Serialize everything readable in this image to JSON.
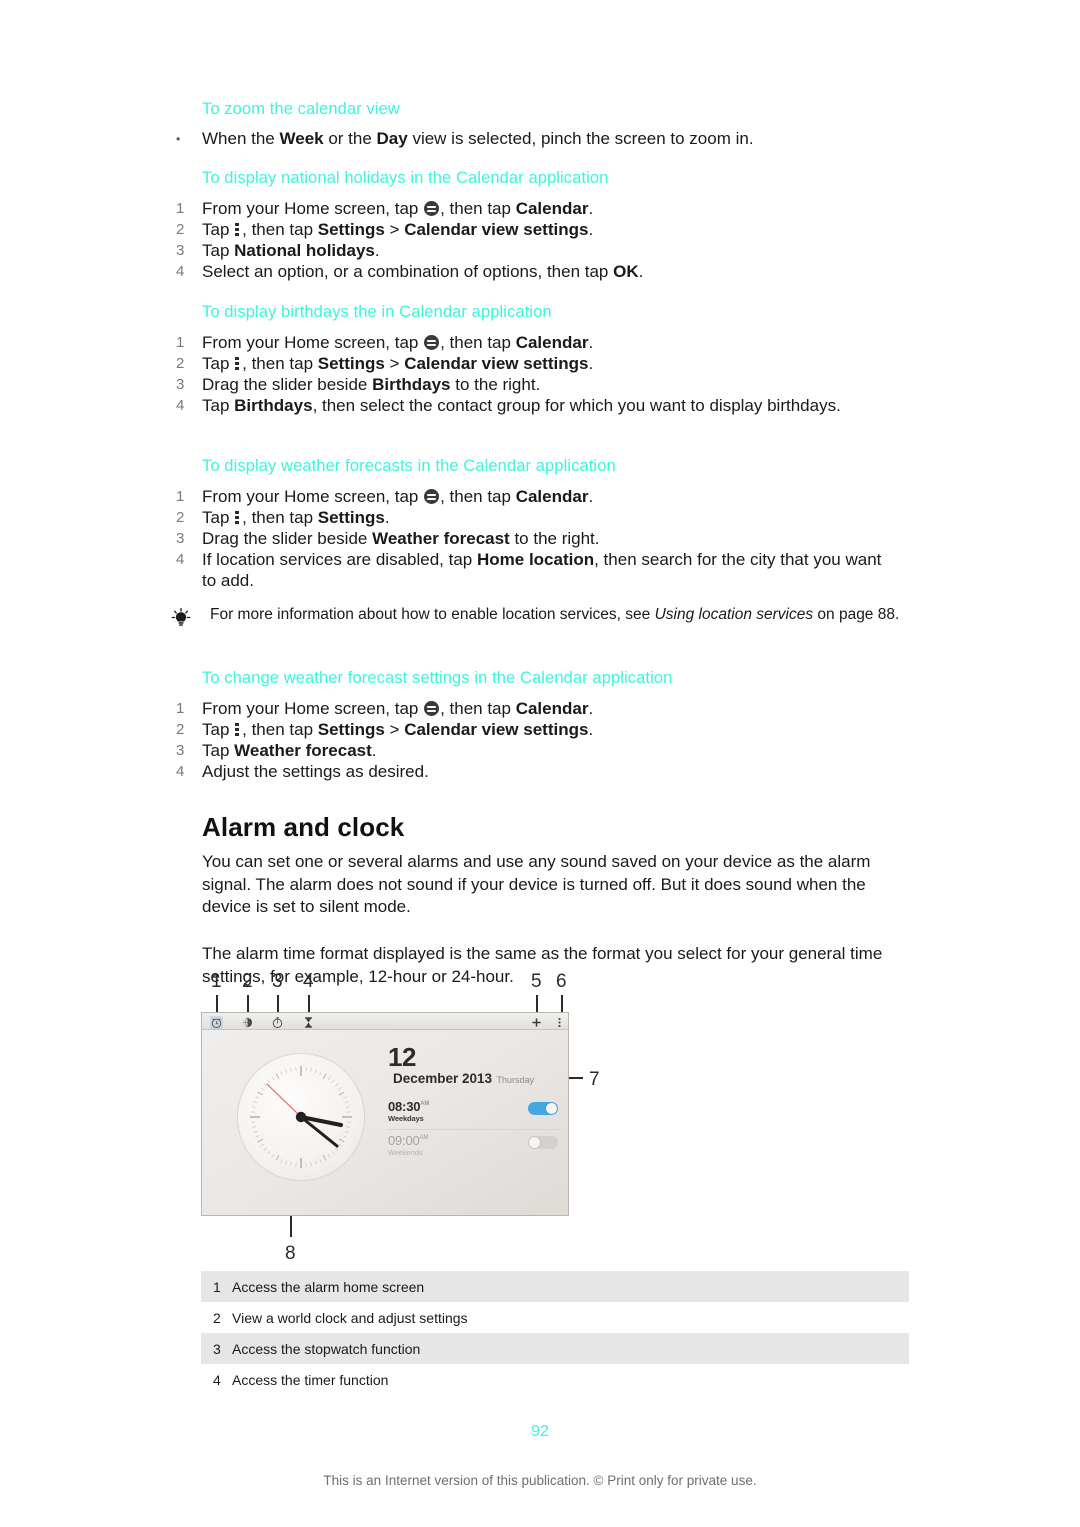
{
  "sections": [
    {
      "heading": "To zoom the calendar view",
      "steps": [
        {
          "marker": "•",
          "parts": [
            {
              "t": "When the ",
              "s": "n"
            },
            {
              "t": "Week",
              "s": "b"
            },
            {
              "t": " or the ",
              "s": "n"
            },
            {
              "t": "Day",
              "s": "b"
            },
            {
              "t": " view is selected, pinch the screen to zoom in.",
              "s": "n"
            }
          ]
        }
      ]
    },
    {
      "heading": "To display national holidays in the Calendar application",
      "steps": [
        {
          "marker": "1",
          "parts": [
            {
              "t": "From your Home screen, tap ",
              "s": "n"
            },
            {
              "t": "",
              "s": "icon-appdrawer"
            },
            {
              "t": ", then tap ",
              "s": "n"
            },
            {
              "t": "Calendar",
              "s": "b"
            },
            {
              "t": ".",
              "s": "n"
            }
          ]
        },
        {
          "marker": "2",
          "parts": [
            {
              "t": "Tap ",
              "s": "n"
            },
            {
              "t": "",
              "s": "icon-overflow"
            },
            {
              "t": ", then tap ",
              "s": "n"
            },
            {
              "t": "Settings",
              "s": "b"
            },
            {
              "t": " > ",
              "s": "n"
            },
            {
              "t": "Calendar view settings",
              "s": "b"
            },
            {
              "t": ".",
              "s": "n"
            }
          ]
        },
        {
          "marker": "3",
          "parts": [
            {
              "t": "Tap ",
              "s": "n"
            },
            {
              "t": "National holidays",
              "s": "b"
            },
            {
              "t": ".",
              "s": "n"
            }
          ]
        },
        {
          "marker": "4",
          "parts": [
            {
              "t": "Select an option, or a combination of options, then tap ",
              "s": "n"
            },
            {
              "t": "OK",
              "s": "b"
            },
            {
              "t": ".",
              "s": "n"
            }
          ]
        }
      ]
    },
    {
      "heading": "To display birthdays the in Calendar application",
      "steps": [
        {
          "marker": "1",
          "parts": [
            {
              "t": "From your Home screen, tap ",
              "s": "n"
            },
            {
              "t": "",
              "s": "icon-appdrawer"
            },
            {
              "t": ", then tap ",
              "s": "n"
            },
            {
              "t": "Calendar",
              "s": "b"
            },
            {
              "t": ".",
              "s": "n"
            }
          ]
        },
        {
          "marker": "2",
          "parts": [
            {
              "t": "Tap ",
              "s": "n"
            },
            {
              "t": "",
              "s": "icon-overflow"
            },
            {
              "t": ", then tap ",
              "s": "n"
            },
            {
              "t": "Settings",
              "s": "b"
            },
            {
              "t": " > ",
              "s": "n"
            },
            {
              "t": "Calendar view settings",
              "s": "b"
            },
            {
              "t": ".",
              "s": "n"
            }
          ]
        },
        {
          "marker": "3",
          "parts": [
            {
              "t": "Drag the slider beside ",
              "s": "n"
            },
            {
              "t": "Birthdays",
              "s": "b"
            },
            {
              "t": " to the right.",
              "s": "n"
            }
          ]
        },
        {
          "marker": "4",
          "parts": [
            {
              "t": "Tap ",
              "s": "n"
            },
            {
              "t": "Birthdays",
              "s": "b"
            },
            {
              "t": ", then select the contact group for which you want to display birthdays.",
              "s": "n"
            }
          ]
        }
      ]
    },
    {
      "heading": "To display weather forecasts in the Calendar application",
      "steps": [
        {
          "marker": "1",
          "parts": [
            {
              "t": "From your Home screen, tap ",
              "s": "n"
            },
            {
              "t": "",
              "s": "icon-appdrawer"
            },
            {
              "t": ", then tap ",
              "s": "n"
            },
            {
              "t": "Calendar",
              "s": "b"
            },
            {
              "t": ".",
              "s": "n"
            }
          ]
        },
        {
          "marker": "2",
          "parts": [
            {
              "t": "Tap ",
              "s": "n"
            },
            {
              "t": "",
              "s": "icon-overflow"
            },
            {
              "t": ", then tap ",
              "s": "n"
            },
            {
              "t": "Settings",
              "s": "b"
            },
            {
              "t": ".",
              "s": "n"
            }
          ]
        },
        {
          "marker": "3",
          "parts": [
            {
              "t": "Drag the slider beside ",
              "s": "n"
            },
            {
              "t": "Weather forecast",
              "s": "b"
            },
            {
              "t": " to the right.",
              "s": "n"
            }
          ]
        },
        {
          "marker": "4",
          "parts": [
            {
              "t": "If location services are disabled, tap ",
              "s": "n"
            },
            {
              "t": "Home location",
              "s": "b"
            },
            {
              "t": ", then search for the city that you want to add.",
              "s": "n"
            }
          ]
        }
      ]
    },
    {
      "heading": "To change weather forecast settings in the Calendar application",
      "steps": [
        {
          "marker": "1",
          "parts": [
            {
              "t": "From your Home screen, tap ",
              "s": "n"
            },
            {
              "t": "",
              "s": "icon-appdrawer"
            },
            {
              "t": ", then tap ",
              "s": "n"
            },
            {
              "t": "Calendar",
              "s": "b"
            },
            {
              "t": ".",
              "s": "n"
            }
          ]
        },
        {
          "marker": "2",
          "parts": [
            {
              "t": "Tap ",
              "s": "n"
            },
            {
              "t": "",
              "s": "icon-overflow"
            },
            {
              "t": ", then tap ",
              "s": "n"
            },
            {
              "t": "Settings",
              "s": "b"
            },
            {
              "t": " > ",
              "s": "n"
            },
            {
              "t": "Calendar view settings",
              "s": "b"
            },
            {
              "t": ".",
              "s": "n"
            }
          ]
        },
        {
          "marker": "3",
          "parts": [
            {
              "t": "Tap ",
              "s": "n"
            },
            {
              "t": "Weather forecast",
              "s": "b"
            },
            {
              "t": ".",
              "s": "n"
            }
          ]
        },
        {
          "marker": "4",
          "parts": [
            {
              "t": "Adjust the settings as desired.",
              "s": "n"
            }
          ]
        }
      ]
    }
  ],
  "tip": {
    "icon": "lightbulb-icon",
    "parts": [
      {
        "t": "For more information about how to enable location services, see ",
        "s": "n"
      },
      {
        "t": "Using location services",
        "s": "i"
      },
      {
        "t": " on page 88.",
        "s": "n"
      }
    ]
  },
  "alarm_section": {
    "title": "Alarm and clock",
    "paragraph1": "You can set one or several alarms and use any sound saved on your device as the alarm signal. The alarm does not sound if your device is turned off. But it does sound when the device is set to silent mode.",
    "paragraph2": "The alarm time format displayed is the same as the format you select for your general time settings, for example, 12-hour or 24-hour."
  },
  "figure": {
    "callouts": [
      "1",
      "2",
      "3",
      "4",
      "5",
      "6",
      "7",
      "8"
    ],
    "toolbar_icons": [
      {
        "name": "alarm-clock-icon",
        "active": true
      },
      {
        "name": "world-clock-globe-icon",
        "active": false
      },
      {
        "name": "stopwatch-icon",
        "active": false
      },
      {
        "name": "timer-hourglass-icon",
        "active": false
      },
      {
        "name": "add-plus-icon",
        "active": false
      },
      {
        "name": "overflow-menu-icon",
        "active": false
      }
    ],
    "date": {
      "day": "12",
      "month_year": "December 2013",
      "weekday": "Thursday"
    },
    "alarms": [
      {
        "time": "08:30",
        "suffix": "AM",
        "repeat": "Weekdays",
        "enabled": true
      },
      {
        "time": "09:00",
        "suffix": "AM",
        "repeat": "Weekends",
        "enabled": false
      }
    ],
    "clock_face": "analog-clock-icon"
  },
  "legend": {
    "rows": [
      {
        "num": "1",
        "desc": "Access the alarm home screen"
      },
      {
        "num": "2",
        "desc": "View a world clock and adjust settings"
      },
      {
        "num": "3",
        "desc": "Access the stopwatch function"
      },
      {
        "num": "4",
        "desc": "Access the timer function"
      }
    ]
  },
  "footer": {
    "page_number": "92",
    "notice": "This is an Internet version of this publication. © Print only for private use."
  },
  "colors": {
    "heading_accent": "#3bf5dd",
    "toggle_on": "#43a7e0",
    "legend_alt_row": "#e6e6e6",
    "second_hand": "#e8605a"
  }
}
